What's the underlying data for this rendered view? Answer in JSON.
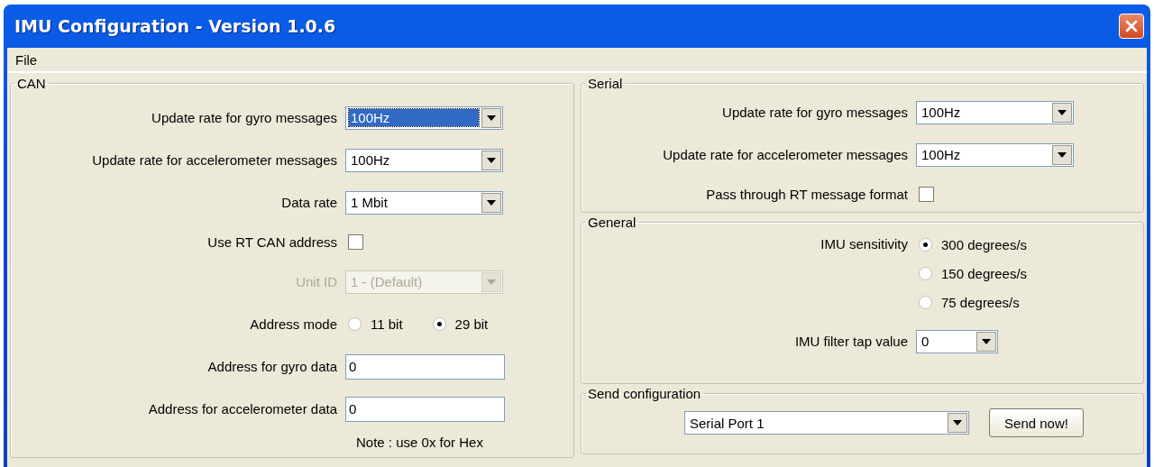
{
  "window": {
    "title": "IMU Configuration - Version 1.0.6"
  },
  "menu": [
    {
      "label": "File"
    }
  ],
  "can": {
    "title": "CAN",
    "rows": [
      {
        "kind": "dropdown",
        "label": "Update rate for gyro messages",
        "value": "100Hz",
        "focused": true,
        "disabled": false
      },
      {
        "kind": "dropdown",
        "label": "Update rate for accelerometer messages",
        "value": "100Hz",
        "focused": false,
        "disabled": false
      },
      {
        "kind": "dropdown",
        "label": "Data rate",
        "value": "1 Mbit",
        "focused": false,
        "disabled": false
      },
      {
        "kind": "checkbox",
        "label": "Use RT CAN address",
        "checked": false,
        "disabled": false
      },
      {
        "kind": "dropdown",
        "label": "Unit ID",
        "value": "1 - (Default)",
        "focused": false,
        "disabled": true
      },
      {
        "kind": "radio-row",
        "label": "Address mode",
        "disabled": false,
        "options": [
          {
            "label": "11 bit",
            "selected": false
          },
          {
            "label": "29 bit",
            "selected": true
          }
        ]
      },
      {
        "kind": "text",
        "label": "Address for gyro data",
        "value": "0",
        "disabled": false
      },
      {
        "kind": "text",
        "label": "Address for accelerometer data",
        "value": "0",
        "disabled": false
      },
      {
        "kind": "note",
        "text": "Note : use 0x for Hex"
      }
    ]
  },
  "serial": {
    "title": "Serial",
    "rows": [
      {
        "kind": "dropdown",
        "label": "Update rate for gyro messages",
        "value": "100Hz",
        "focused": false,
        "disabled": false
      },
      {
        "kind": "dropdown",
        "label": "Update rate for accelerometer messages",
        "value": "100Hz",
        "focused": false,
        "disabled": false
      },
      {
        "kind": "checkbox",
        "label": "Pass through RT message format",
        "checked": false,
        "disabled": false
      }
    ]
  },
  "general": {
    "title": "General",
    "rows": [
      {
        "kind": "radio-column",
        "label": "IMU sensitivity",
        "disabled": false,
        "options": [
          {
            "label": "300 degrees/s",
            "selected": true
          },
          {
            "label": "150 degrees/s",
            "selected": false
          },
          {
            "label": "75 degrees/s",
            "selected": false
          }
        ]
      },
      {
        "kind": "short-dropdown",
        "label": "IMU filter tap value",
        "value": "0",
        "focused": false,
        "disabled": false
      }
    ]
  },
  "send": {
    "title": "Send configuration",
    "port": "Serial Port 1",
    "button": "Send now!"
  }
}
